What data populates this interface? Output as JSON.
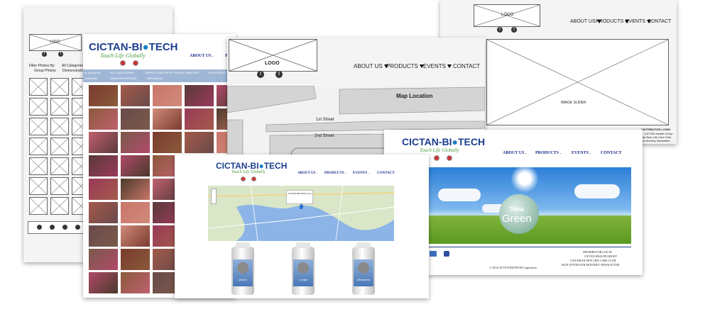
{
  "wf_gallery": {
    "logo": "LOGO",
    "filter_label": "Filter Photos By:",
    "filter_all": "All Categories",
    "filter_group": "Group Photos",
    "filter_demo": "Demonstration"
  },
  "gallery": {
    "brand": "CICTAN-BI",
    "brand2": "TECH",
    "tagline": "Touch Life Globally",
    "nav_about": "ABOUT US .",
    "nav_pr": "PR",
    "filter_prefix": "er photos by:",
    "cats": [
      "ALL CATEGORIES",
      "DEPUTY MAYOR OF FUZHOU MEETING",
      "2014 INTEGR",
      "DANCING",
      "DEMONSTRATIONS",
      "SPEAKERS"
    ]
  },
  "wf_contact": {
    "logo": "LOGO",
    "nav": [
      "ABOUT US",
      "PRODUCTS",
      "EVENTS",
      "CONTACT"
    ],
    "map_location": "Map Location",
    "street1": "1st Street",
    "street2": "2nd Street"
  },
  "wf_home": {
    "logo": "LOGO",
    "nav": [
      "ABOUT US",
      "PRODUCTS",
      "EVENTS",
      "CONTACT"
    ],
    "slider": "IMAGE SLIDER",
    "footer": [
      "DISTRIBUTOR LOGIN",
      "CICTAN Health Group",
      "Nan New Life Care Club",
      "Our Monthly Newsletter"
    ]
  },
  "contact": {
    "brand": "CICTAN-BI",
    "brand2": "TECH",
    "tagline": "Touch Life Globally",
    "nav": [
      "ABOUT US .",
      "PRODUCTS .",
      "EVENTS .",
      "CONTACT"
    ],
    "map_address": "CICTAN-BIOTECH Corp",
    "bottles": [
      "phone",
      "e-mail",
      "Directions"
    ]
  },
  "home": {
    "brand": "CICTAN-BI",
    "brand2": "TECH",
    "tagline": "Touch Life Globally",
    "nav": [
      "ABOUT US .",
      "PRODUCTS .",
      "EVENTS .",
      "CONTACT"
    ],
    "think": "Think",
    "green": "Green",
    "footer_links": [
      "DISTRIBUTOR LOG IN",
      "CICTAN HEALTH GROUP",
      "CANADIAN NEW LIFE CARE CLUB",
      "SIGN UP FOR OUR MONTHLY NEWSLETTER"
    ],
    "copyright": "© 2014 CICTAN-BIOTECH Corporation"
  },
  "colors": {
    "brand": "#1d3f8f",
    "nav": "#1a2a8a",
    "tagline": "#4a9a3a",
    "catbar": "#9fb6d6",
    "map_water": "#8cb4e6",
    "map_land": "#d9e6c7"
  }
}
